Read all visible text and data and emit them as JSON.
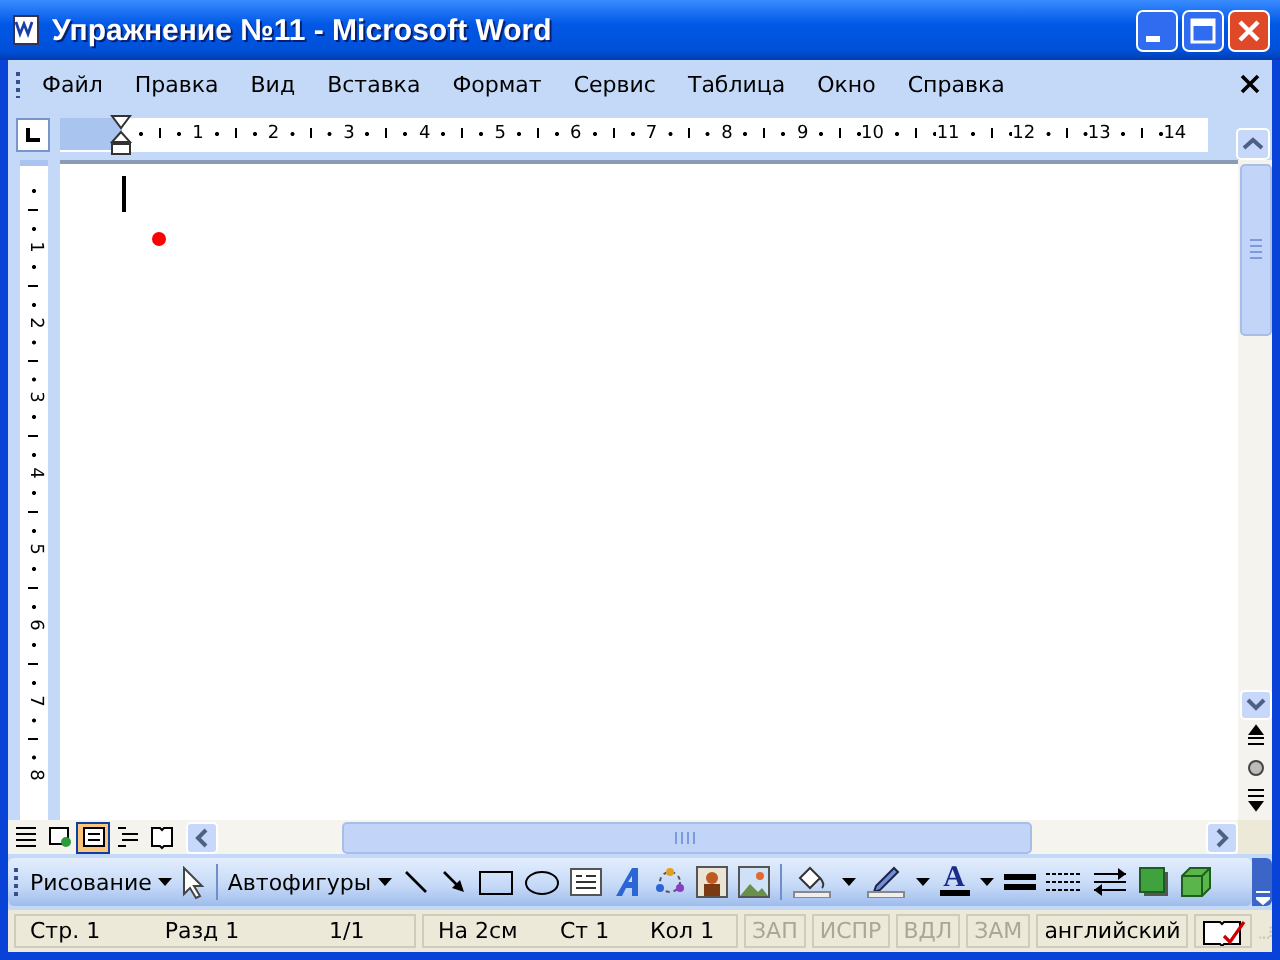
{
  "window": {
    "title": "Упражнение №11 - Microsoft Word"
  },
  "menu": {
    "items": [
      "Файл",
      "Правка",
      "Вид",
      "Вставка",
      "Формат",
      "Сервис",
      "Таблица",
      "Окно",
      "Справка"
    ]
  },
  "ruler": {
    "numbers": [
      "1",
      "2",
      "3",
      "4",
      "5",
      "6",
      "7",
      "8",
      "9",
      "10",
      "11",
      "12",
      "13",
      "14"
    ]
  },
  "vertical_ruler": {
    "numbers": [
      "1",
      "2",
      "3",
      "4",
      "5",
      "6",
      "7",
      "8"
    ]
  },
  "view_modes": [
    {
      "selected": false
    },
    {
      "selected": false
    },
    {
      "selected": true
    },
    {
      "selected": false
    },
    {
      "selected": false
    }
  ],
  "drawing_toolbar": {
    "drawing_menu": "Рисование",
    "autoshapes_menu": "Автофигуры",
    "font_color_glyph": "A"
  },
  "status_bar": {
    "fields": [
      "Стр. 1",
      "Разд 1",
      "1/1",
      "На 2см",
      "Ст 1",
      "Кол 1"
    ],
    "modes": [
      {
        "label": "ЗАП",
        "on": false
      },
      {
        "label": "ИСПР",
        "on": false
      },
      {
        "label": "ВДЛ",
        "on": false
      },
      {
        "label": "ЗАМ",
        "on": false
      }
    ],
    "language": "английский"
  }
}
